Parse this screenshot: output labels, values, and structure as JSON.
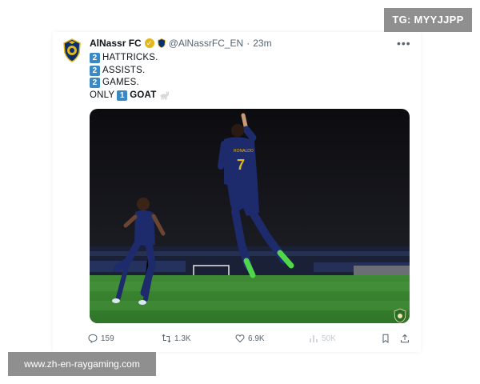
{
  "watermarks": {
    "top_right": "TG: MYYJJPP",
    "bottom_left": "www.zh-en-raygaming.com"
  },
  "tweet": {
    "display_name": "AlNassr FC",
    "handle": "@AlNassrFC_EN",
    "separator": "·",
    "time": "23m",
    "lines": [
      {
        "number": "2",
        "text": "HATTRICKS."
      },
      {
        "number": "2",
        "text": "ASSISTS."
      },
      {
        "number": "2",
        "text": "GAMES."
      }
    ],
    "last_line": {
      "prefix": "ONLY",
      "number": "1",
      "word": "GOAT"
    },
    "photo": {
      "jersey_name": "RONALDO",
      "jersey_number": "7"
    },
    "actions": {
      "replies": "159",
      "retweets": "1.3K",
      "likes": "6.9K",
      "views": "50K"
    }
  },
  "colors": {
    "keycap": "#3b88c3",
    "verified": "#e2b719",
    "muted": "#536471",
    "pitch": "#3f8a34",
    "kit": "#1d2a6b"
  }
}
